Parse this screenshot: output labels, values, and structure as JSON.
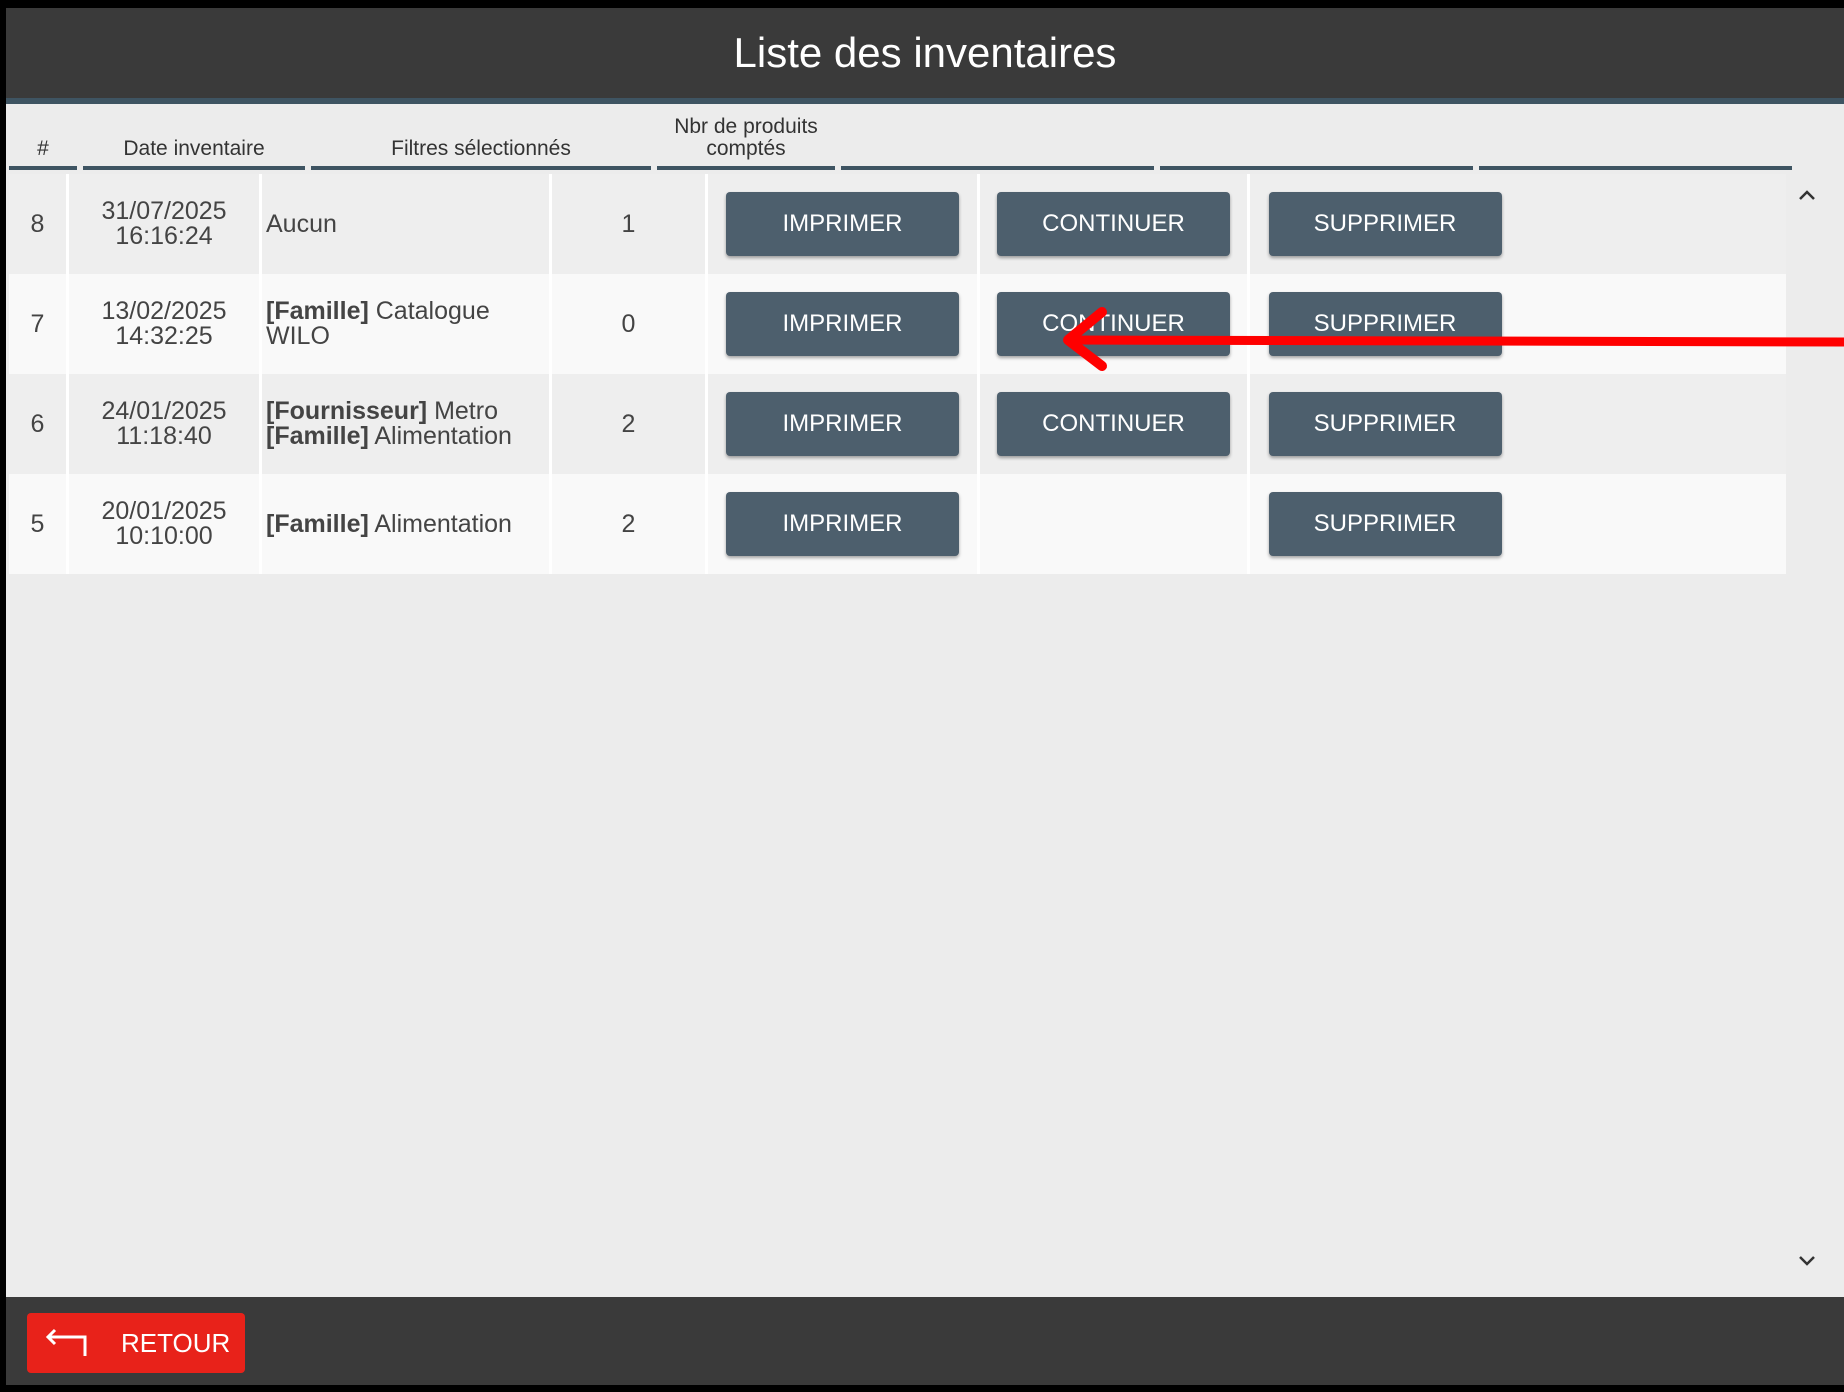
{
  "title": "Liste des inventaires",
  "table": {
    "headers": {
      "num": "#",
      "date": "Date inventaire",
      "filters": "Filtres sélectionnés",
      "count_line1": "Nbr de produits",
      "count_line2": "comptés"
    },
    "rows": [
      {
        "num": "8",
        "date": "31/07/2025",
        "time": "16:16:24",
        "filters": [
          {
            "label": "",
            "value": "Aucun"
          }
        ],
        "count": "1",
        "print": "IMPRIMER",
        "continue": "CONTINUER",
        "delete": "SUPPRIMER"
      },
      {
        "num": "7",
        "date": "13/02/2025",
        "time": "14:32:25",
        "filters": [
          {
            "label": "[Famille]",
            "value": " Catalogue WILO"
          }
        ],
        "count": "0",
        "print": "IMPRIMER",
        "continue": "CONTINUER",
        "delete": "SUPPRIMER"
      },
      {
        "num": "6",
        "date": "24/01/2025",
        "time": "11:18:40",
        "filters": [
          {
            "label": "[Fournisseur]",
            "value": " Metro"
          },
          {
            "label": "[Famille]",
            "value": " Alimentation"
          }
        ],
        "count": "2",
        "print": "IMPRIMER",
        "continue": "CONTINUER",
        "delete": "SUPPRIMER"
      },
      {
        "num": "5",
        "date": "20/01/2025",
        "time": "10:10:00",
        "filters": [
          {
            "label": "[Famille]",
            "value": " Alimentation"
          }
        ],
        "count": "2",
        "print": "IMPRIMER",
        "continue": "",
        "delete": "SUPPRIMER"
      }
    ]
  },
  "footer": {
    "back_label": "RETOUR",
    "back_icon": "return-arrow-icon"
  },
  "colors": {
    "bar": "#3a3a3a",
    "accent_line": "#3e5462",
    "button": "#4d5f6d",
    "back_button": "#e8221a",
    "annotation": "#ff0000"
  }
}
